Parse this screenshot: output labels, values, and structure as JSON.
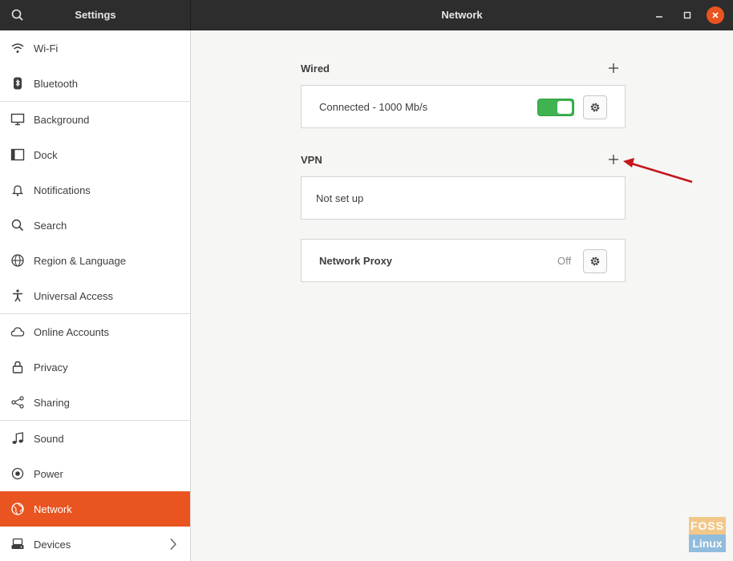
{
  "window": {
    "sidebar_title": "Settings",
    "title": "Network"
  },
  "sidebar": {
    "items": [
      {
        "label": "Wi-Fi",
        "icon": "wifi-icon"
      },
      {
        "label": "Bluetooth",
        "icon": "bluetooth-icon"
      },
      {
        "label": "Background",
        "icon": "monitor-icon"
      },
      {
        "label": "Dock",
        "icon": "dock-icon"
      },
      {
        "label": "Notifications",
        "icon": "bell-icon"
      },
      {
        "label": "Search",
        "icon": "search-icon"
      },
      {
        "label": "Region & Language",
        "icon": "globe-icon"
      },
      {
        "label": "Universal Access",
        "icon": "accessibility-icon"
      },
      {
        "label": "Online Accounts",
        "icon": "cloud-icon"
      },
      {
        "label": "Privacy",
        "icon": "lock-icon"
      },
      {
        "label": "Sharing",
        "icon": "share-icon"
      },
      {
        "label": "Sound",
        "icon": "music-note-icon"
      },
      {
        "label": "Power",
        "icon": "power-icon"
      },
      {
        "label": "Network",
        "icon": "network-icon",
        "selected": true
      },
      {
        "label": "Devices",
        "icon": "devices-icon"
      }
    ]
  },
  "wired": {
    "title": "Wired",
    "status": "Connected - 1000 Mb/s",
    "enabled": true
  },
  "vpn": {
    "title": "VPN",
    "status": "Not set up"
  },
  "proxy": {
    "title": "Network Proxy",
    "state": "Off"
  },
  "watermark": {
    "line1": "FOSS",
    "line2": "Linux"
  },
  "colors": {
    "accent": "#e95420",
    "toggle_on": "#3eb34f",
    "header": "#2d2d2d",
    "annotation_arrow": "#c4161c"
  }
}
